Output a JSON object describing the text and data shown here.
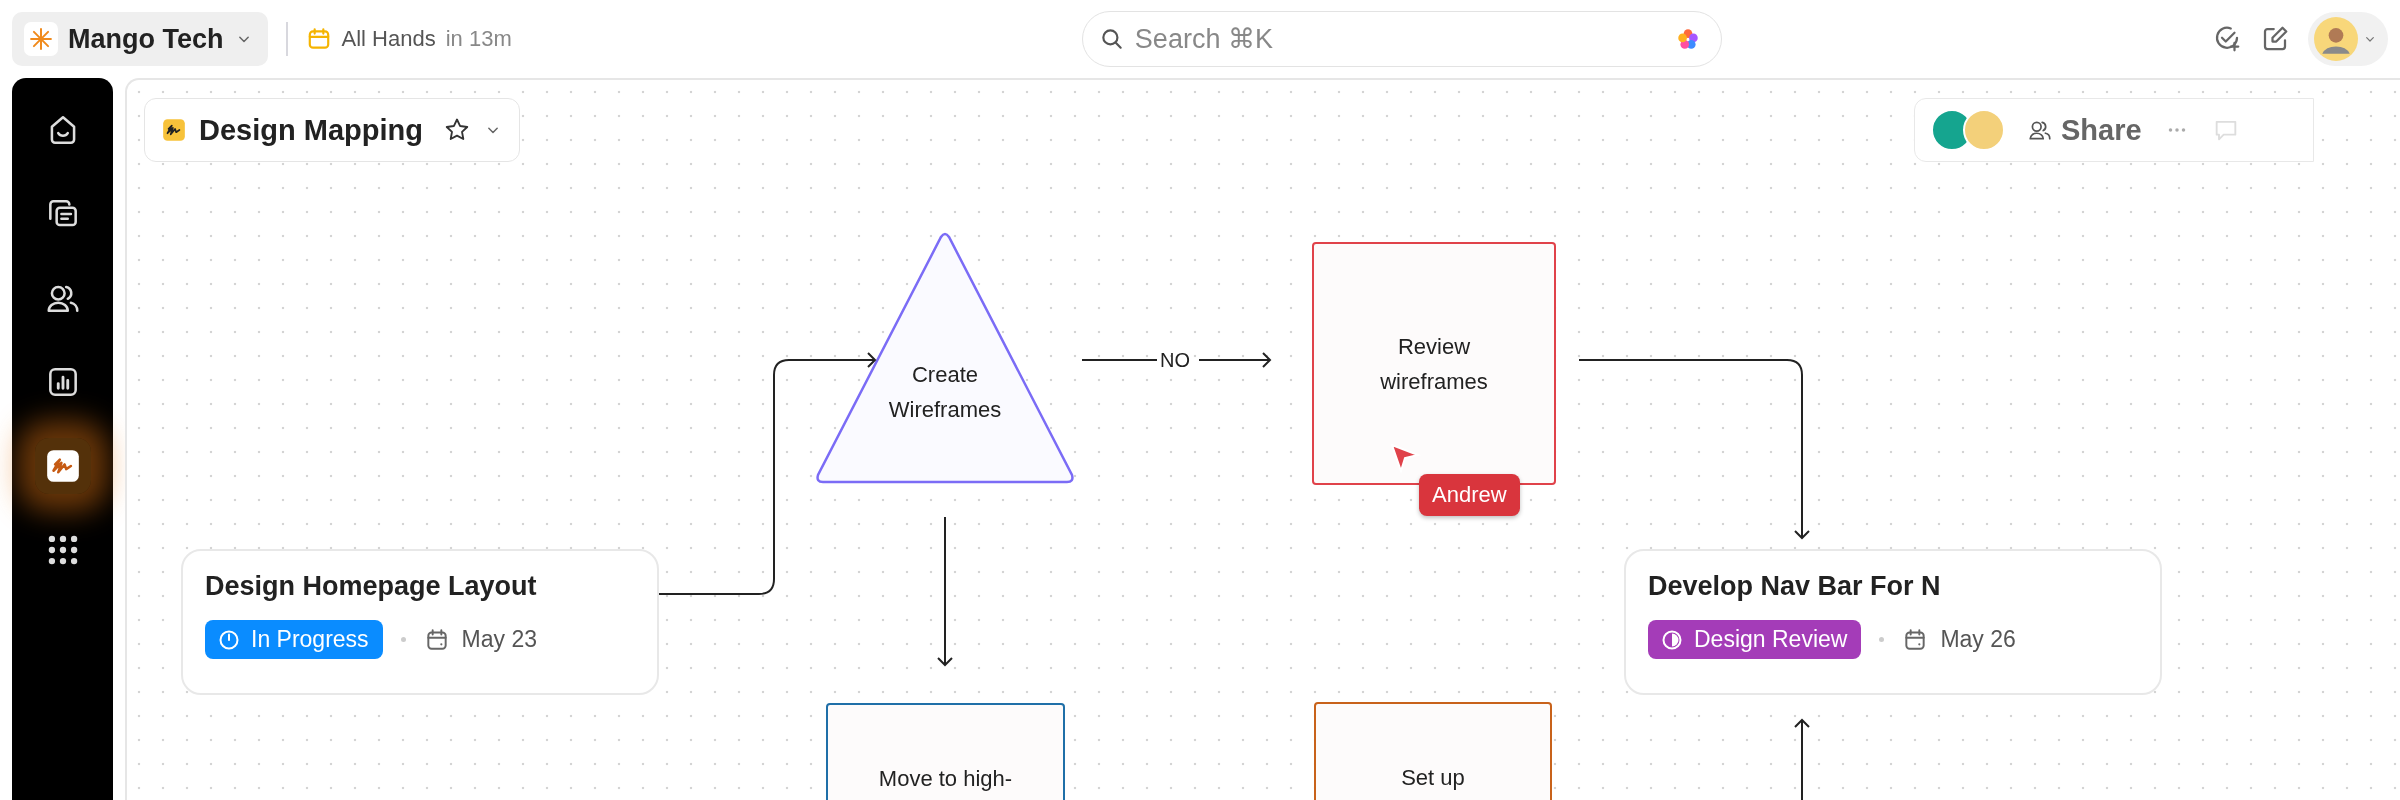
{
  "workspace": {
    "name": "Mango Tech"
  },
  "meeting": {
    "title": "All Hands",
    "time": "in 13m"
  },
  "search": {
    "placeholder": "Search ⌘K"
  },
  "sidebar": {
    "items": [
      {
        "kind": "home",
        "selected": false
      },
      {
        "kind": "chat",
        "selected": false
      },
      {
        "kind": "people",
        "selected": false
      },
      {
        "kind": "chart",
        "selected": false
      },
      {
        "kind": "whiteboard",
        "selected": true
      },
      {
        "kind": "apps",
        "selected": false
      }
    ]
  },
  "board": {
    "title": "Design Mapping",
    "share": "Share"
  },
  "shapes": [
    {
      "kind": "triangle",
      "text": "Create Wireframes",
      "color": "#7b6cf6"
    },
    {
      "kind": "box",
      "text": "Move to high-",
      "color": "#1f6fa8"
    },
    {
      "kind": "box",
      "text": "Review wireframes",
      "color": "#e0424a"
    },
    {
      "kind": "box",
      "text": "Set up",
      "color": "#c8621a"
    }
  ],
  "cards": [
    {
      "title": "Design Homepage Layout",
      "status": {
        "kind": "progress",
        "label": "In Progress",
        "color": "#0a8cff"
      },
      "date": "May 23"
    },
    {
      "title": "Develop Nav Bar For N",
      "status": {
        "kind": "review",
        "label": "Design Review",
        "color": "#a43cb8"
      },
      "date": "May 26"
    }
  ],
  "edge_label": "NO",
  "cursor": {
    "name": "Andrew"
  }
}
